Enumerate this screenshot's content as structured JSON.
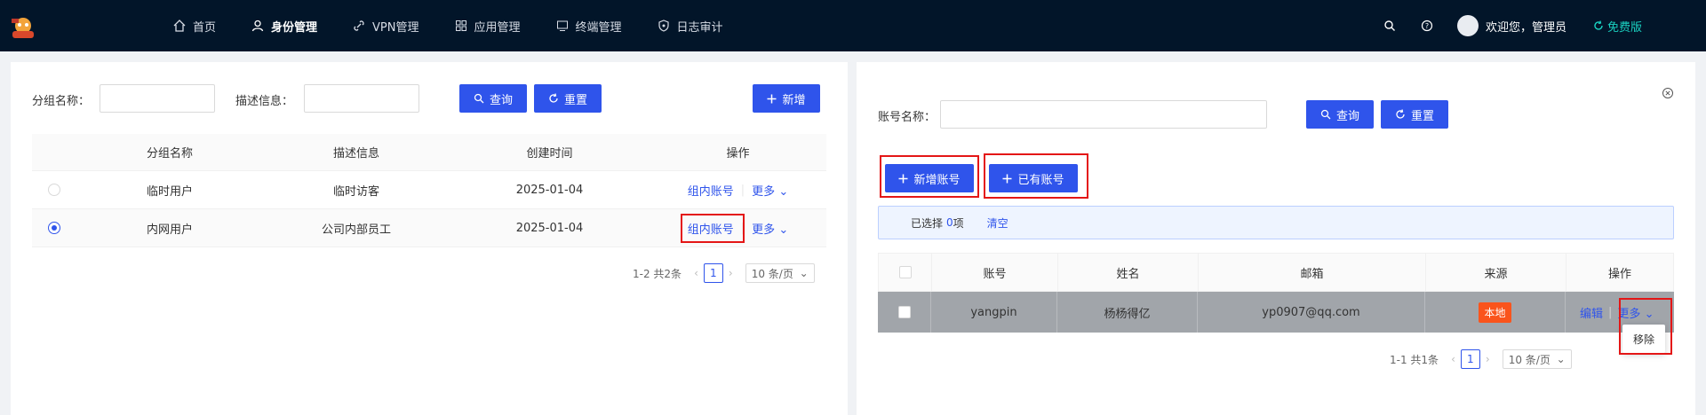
{
  "nav": {
    "items": [
      {
        "label": "首页",
        "icon": "home-icon"
      },
      {
        "label": "身份管理",
        "icon": "user-icon"
      },
      {
        "label": "VPN管理",
        "icon": "link-icon"
      },
      {
        "label": "应用管理",
        "icon": "apps-icon"
      },
      {
        "label": "终端管理",
        "icon": "monitor-icon"
      },
      {
        "label": "日志审计",
        "icon": "shield-icon"
      }
    ],
    "welcome": "欢迎您，管理员",
    "plan": "免费版"
  },
  "left": {
    "filters": {
      "group_name_label": "分组名称：",
      "desc_label": "描述信息："
    },
    "buttons": {
      "query": "查询",
      "reset": "重置",
      "add": "新增"
    },
    "table": {
      "headers": [
        "分组名称",
        "描述信息",
        "创建时间",
        "操作"
      ],
      "rows": [
        {
          "name": "临时用户",
          "desc": "临时访客",
          "created": "2025-01-04",
          "action": "组内账号",
          "more": "更多",
          "selected": false
        },
        {
          "name": "内网用户",
          "desc": "公司内部员工",
          "created": "2025-01-04",
          "action": "组内账号",
          "more": "更多",
          "selected": true
        }
      ]
    },
    "pager": {
      "total": "1-2 共2条",
      "page": "1",
      "size": "10 条/页"
    }
  },
  "right": {
    "filters": {
      "account_label": "账号名称："
    },
    "buttons": {
      "query": "查询",
      "reset": "重置",
      "new_account": "新增账号",
      "existing_account": "已有账号"
    },
    "selection": {
      "prefix": "已选择",
      "count": "0",
      "suffix": "项",
      "clear": "清空"
    },
    "table": {
      "headers": [
        "账号",
        "姓名",
        "邮箱",
        "来源",
        "操作"
      ],
      "rows": [
        {
          "account": "yangpin",
          "name": "杨杨得亿",
          "email": "yp0907@qq.com",
          "source": "本地",
          "edit": "编辑",
          "more": "更多"
        }
      ]
    },
    "dropdown": {
      "remove": "移除"
    },
    "pager": {
      "total": "1-1 共1条",
      "page": "1",
      "size": "10 条/页"
    }
  },
  "colors": {
    "primary": "#2f54eb",
    "topbar": "#021529",
    "local_badge": "#fa541c",
    "highlight": "#e41616",
    "plan": "#1ad1c1"
  }
}
